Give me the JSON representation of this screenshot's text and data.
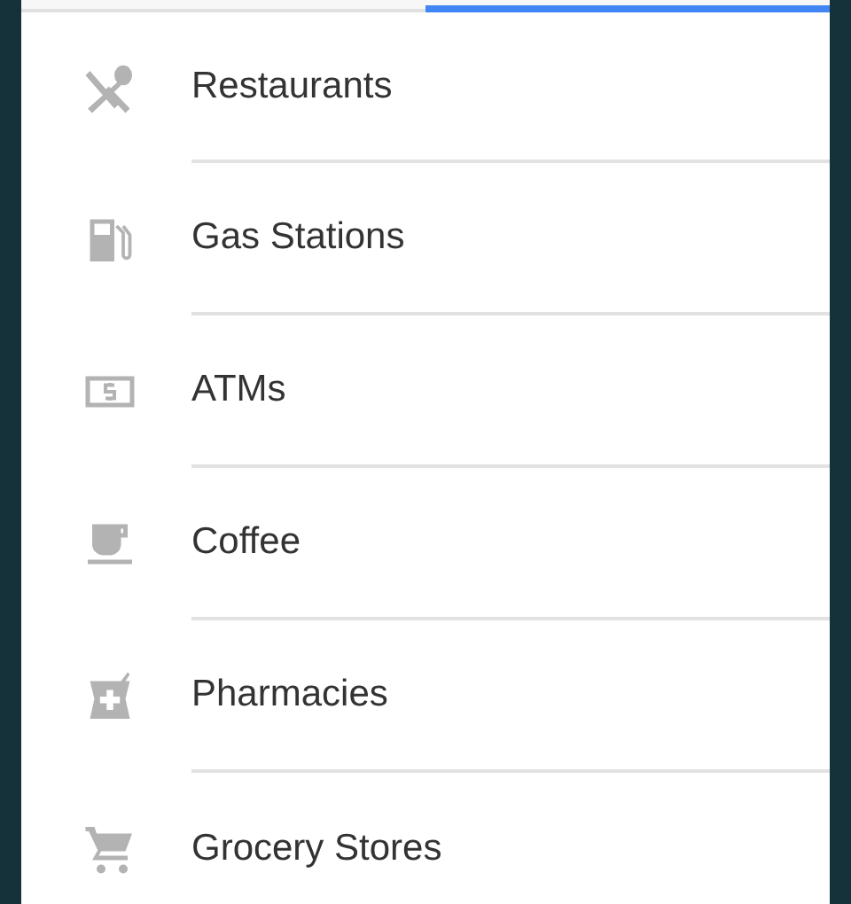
{
  "tabs": [
    {
      "selected": false
    },
    {
      "selected": true
    }
  ],
  "categories": [
    {
      "kind": "restaurant",
      "label": "Restaurants"
    },
    {
      "kind": "gas",
      "label": "Gas Stations"
    },
    {
      "kind": "atm",
      "label": "ATMs"
    },
    {
      "kind": "coffee",
      "label": "Coffee"
    },
    {
      "kind": "pharmacy",
      "label": "Pharmacies"
    },
    {
      "kind": "grocery",
      "label": "Grocery Stores"
    }
  ]
}
